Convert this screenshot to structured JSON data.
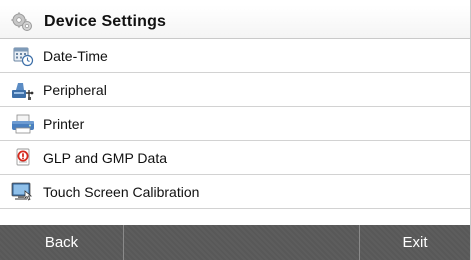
{
  "header": {
    "title": "Device Settings",
    "icon": "gears-icon"
  },
  "items": [
    {
      "label": "Date-Time",
      "icon": "calendar-clock-icon"
    },
    {
      "label": "Peripheral",
      "icon": "peripheral-device-icon"
    },
    {
      "label": "Printer",
      "icon": "printer-icon"
    },
    {
      "label": "GLP and GMP Data",
      "icon": "glp-gmp-document-icon",
      "accent": "#d62a1e"
    },
    {
      "label": "Touch Screen Calibration",
      "icon": "touch-monitor-icon"
    }
  ],
  "footer": {
    "back_label": "Back",
    "exit_label": "Exit"
  },
  "colors": {
    "footer_bg": "#5c5c5c",
    "footer_text": "#ffffff",
    "row_divider": "#d2d2d2"
  }
}
